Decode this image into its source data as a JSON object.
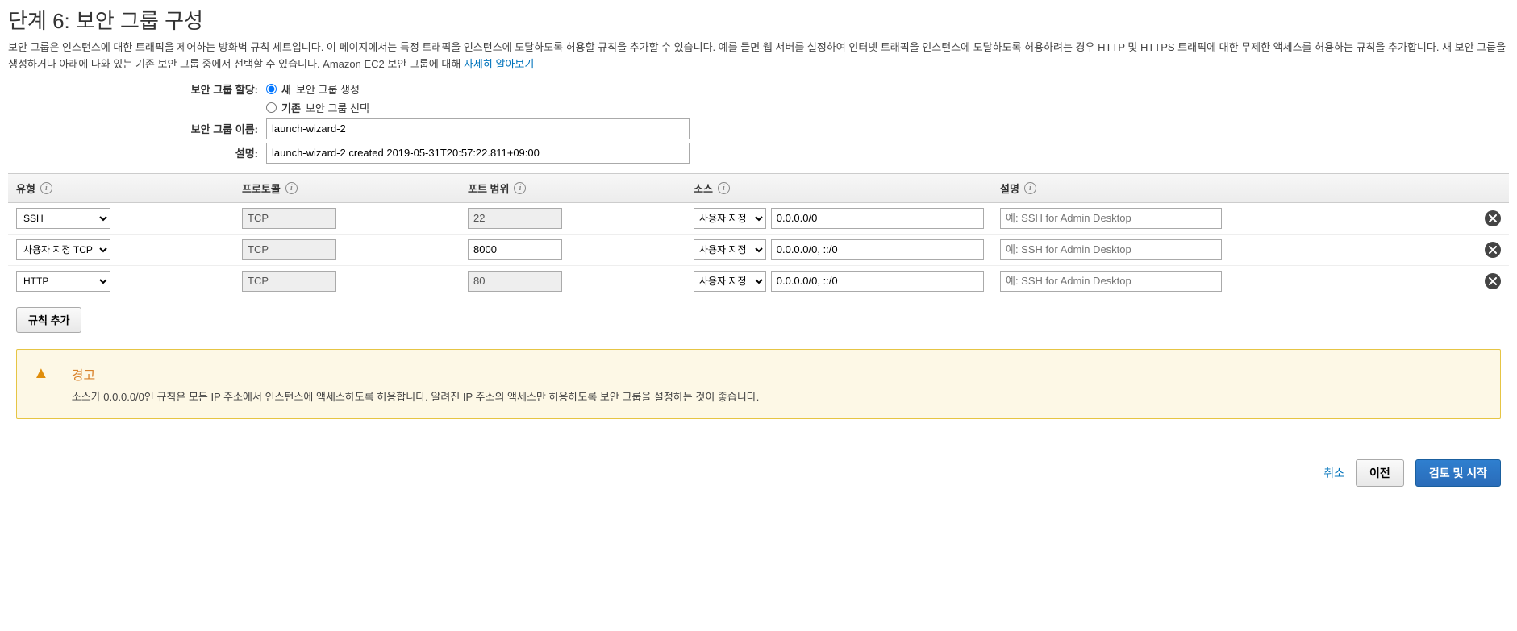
{
  "heading": "단계 6: 보안 그룹 구성",
  "description": "보안 그룹은 인스턴스에 대한 트래픽을 제어하는 방화벽 규칙 세트입니다. 이 페이지에서는 특정 트래픽을 인스턴스에 도달하도록 허용할 규칙을 추가할 수 있습니다. 예를 들면 웹 서버를 설정하여 인터넷 트래픽을 인스턴스에 도달하도록 허용하려는 경우 HTTP 및 HTTPS 트래픽에 대한 무제한 액세스를 허용하는 규칙을 추가합니다. 새 보안 그룹을 생성하거나 아래에 나와 있는 기존 보안 그룹 중에서 선택할 수 있습니다. Amazon EC2 보안 그룹에 대해 ",
  "learn_more": "자세히 알아보기",
  "form": {
    "assign_label": "보안 그룹 할당:",
    "radio_new_bold": "새",
    "radio_new_rest": " 보안 그룹 생성",
    "radio_existing_bold": "기존",
    "radio_existing_rest": " 보안 그룹 선택",
    "name_label": "보안 그룹 이름:",
    "name_value": "launch-wizard-2",
    "desc_label": "설명:",
    "desc_value": "launch-wizard-2 created 2019-05-31T20:57:22.811+09:00"
  },
  "columns": {
    "type": "유형",
    "protocol": "프로토콜",
    "port": "포트 범위",
    "source": "소스",
    "desc": "설명"
  },
  "rules": [
    {
      "type": "SSH",
      "protocol": "TCP",
      "port": "22",
      "port_readonly": true,
      "source_mode": "사용자 지정",
      "source_value": "0.0.0.0/0",
      "desc": "",
      "desc_placeholder": "예: SSH for Admin Desktop"
    },
    {
      "type": "사용자 지정 TCP",
      "protocol": "TCP",
      "port": "8000",
      "port_readonly": false,
      "source_mode": "사용자 지정",
      "source_value": "0.0.0.0/0, ::/0",
      "desc": "",
      "desc_placeholder": "예: SSH for Admin Desktop"
    },
    {
      "type": "HTTP",
      "protocol": "TCP",
      "port": "80",
      "port_readonly": true,
      "source_mode": "사용자 지정",
      "source_value": "0.0.0.0/0, ::/0",
      "desc": "",
      "desc_placeholder": "예: SSH for Admin Desktop"
    }
  ],
  "add_rule": "규칙 추가",
  "warning": {
    "title": "경고",
    "text": "소스가 0.0.0.0/0인 규칙은 모든 IP 주소에서 인스턴스에 액세스하도록 허용합니다. 알려진 IP 주소의 액세스만 허용하도록 보안 그룹을 설정하는 것이 좋습니다."
  },
  "footer": {
    "cancel": "취소",
    "prev": "이전",
    "review": "검토 및 시작"
  }
}
